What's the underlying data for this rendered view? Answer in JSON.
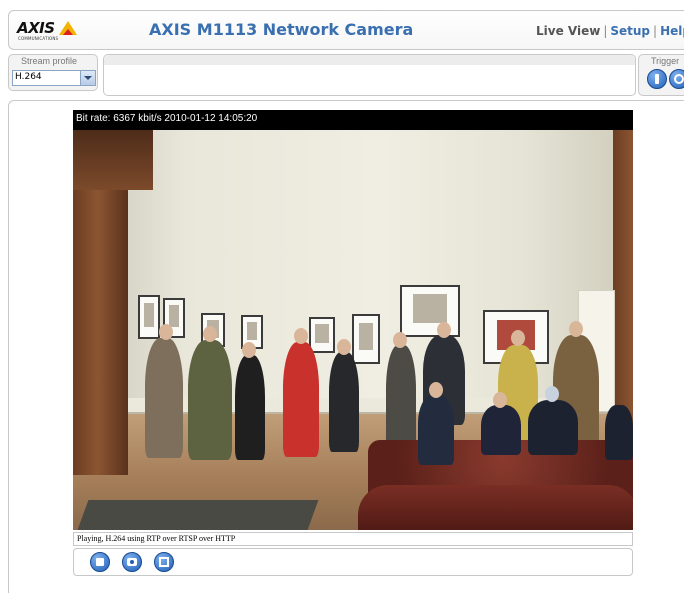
{
  "header": {
    "logo_text": "AXIS",
    "logo_sub": "COMMUNICATIONS",
    "title": "AXIS M1113 Network Camera",
    "nav": {
      "live_view": "Live View",
      "separator": "|",
      "setup": "Setup",
      "help": "Help"
    }
  },
  "stream_profile": {
    "label": "Stream profile",
    "selected": "H.264"
  },
  "trigger": {
    "label": "Trigger"
  },
  "video": {
    "overlay_text": "Bit rate:  6367 kbit/s 2010-01-12 14:05:20",
    "status_text": "Playing, H.264 using RTP over RTSP over HTTP"
  },
  "controls": {
    "buttons": [
      "stop-icon",
      "snapshot-icon",
      "view-full-screen-icon"
    ]
  },
  "colors": {
    "title_blue": "#3a6fb0",
    "button_blue": "#1f5fb8",
    "logo_yellow": "#f2b400"
  }
}
